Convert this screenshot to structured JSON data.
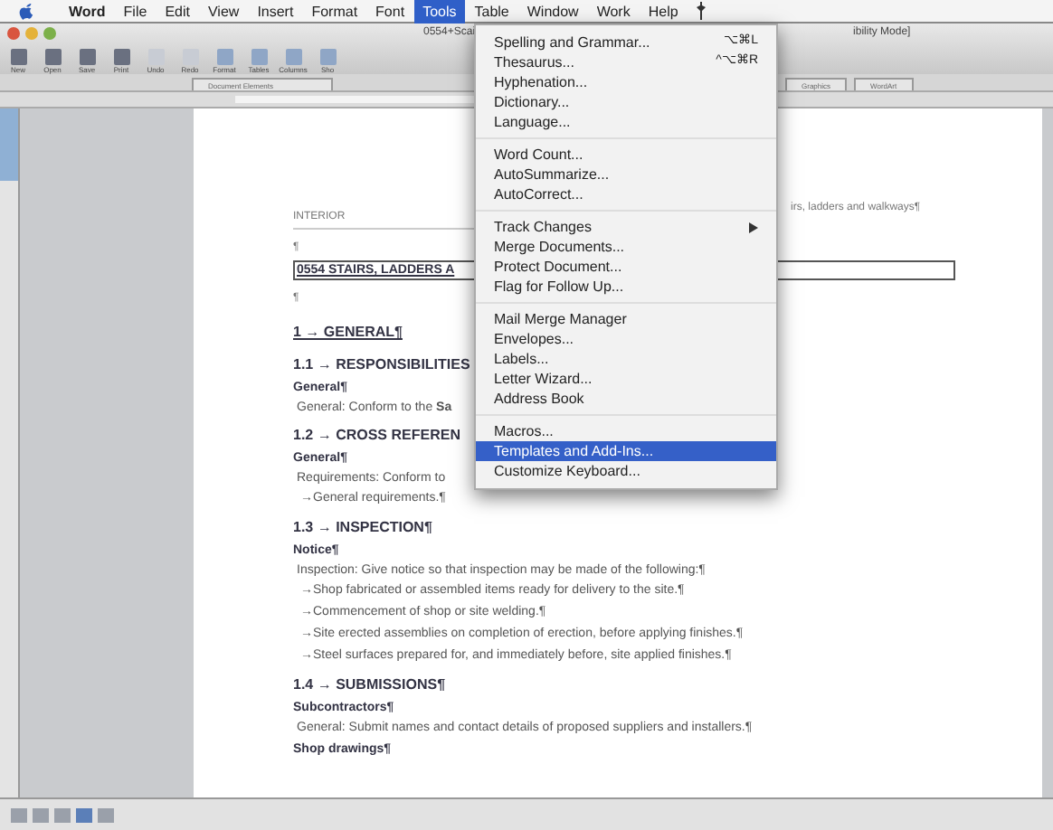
{
  "menubar": [
    {
      "label": "Word",
      "selected": false
    },
    {
      "label": "File",
      "selected": false
    },
    {
      "label": "Edit",
      "selected": false
    },
    {
      "label": "View",
      "selected": false
    },
    {
      "label": "Insert",
      "selected": false
    },
    {
      "label": "Format",
      "selected": false
    },
    {
      "label": "Font",
      "selected": false
    },
    {
      "label": "Tools",
      "selected": true
    },
    {
      "label": "Table",
      "selected": false
    },
    {
      "label": "Window",
      "selected": false
    },
    {
      "label": "Work",
      "selected": false
    },
    {
      "label": "Help",
      "selected": false
    }
  ],
  "window": {
    "title_left": "0554+Scai",
    "title_right": "ibility Mode]"
  },
  "toolbar": [
    {
      "label": "New"
    },
    {
      "label": "Open"
    },
    {
      "label": "Save"
    },
    {
      "label": "Print"
    },
    {
      "label": "Undo"
    },
    {
      "label": "Redo"
    },
    {
      "label": "Format"
    },
    {
      "label": "Tables"
    },
    {
      "label": "Columns"
    },
    {
      "label": "Sho"
    }
  ],
  "ribbon_tabs": [
    {
      "label": "Document Elements",
      "selected": false
    },
    {
      "label": "Graphics",
      "selected": false
    },
    {
      "label": "WordArt",
      "selected": false
    }
  ],
  "tools_menu": [
    {
      "kind": "item",
      "label": "Spelling and Grammar...",
      "shortcut": "⌥⌘L",
      "selected": false
    },
    {
      "kind": "item",
      "label": "Thesaurus...",
      "shortcut": "^⌥⌘R",
      "selected": false
    },
    {
      "kind": "item",
      "label": "Hyphenation...",
      "selected": false
    },
    {
      "kind": "item",
      "label": "Dictionary...",
      "selected": false
    },
    {
      "kind": "item",
      "label": "Language...",
      "selected": false
    },
    {
      "kind": "separator"
    },
    {
      "kind": "item",
      "label": "Word Count...",
      "selected": false
    },
    {
      "kind": "item",
      "label": "AutoSummarize...",
      "selected": false
    },
    {
      "kind": "item",
      "label": "AutoCorrect...",
      "selected": false
    },
    {
      "kind": "separator"
    },
    {
      "kind": "submenu",
      "label": "Track Changes",
      "selected": false
    },
    {
      "kind": "item",
      "label": "Merge Documents...",
      "selected": false
    },
    {
      "kind": "item",
      "label": "Protect Document...",
      "selected": false
    },
    {
      "kind": "item",
      "label": "Flag for Follow Up...",
      "selected": false
    },
    {
      "kind": "separator"
    },
    {
      "kind": "item",
      "label": "Mail Merge Manager",
      "selected": false
    },
    {
      "kind": "item",
      "label": "Envelopes...",
      "selected": false
    },
    {
      "kind": "item",
      "label": "Labels...",
      "selected": false
    },
    {
      "kind": "item",
      "label": "Letter Wizard...",
      "selected": false
    },
    {
      "kind": "item",
      "label": "Address Book",
      "selected": false
    },
    {
      "kind": "separator"
    },
    {
      "kind": "item",
      "label": "Macros...",
      "selected": false
    },
    {
      "kind": "item",
      "label": "Templates and Add-Ins...",
      "selected": true
    },
    {
      "kind": "item",
      "label": "Customize Keyboard...",
      "selected": false
    }
  ],
  "document": {
    "header": "INTERIOR",
    "header_right": "irs, ladders and walkways¶",
    "pilcrow_1": "¶",
    "title": "0554 STAIRS, LADDERS A",
    "pilcrow_2": "¶",
    "lines": [
      {
        "kind": "heading1",
        "text": "1 → GENERAL¶"
      },
      {
        "kind": "heading2",
        "text": "1.1 → RESPONSIBILITIES"
      },
      {
        "kind": "heading3",
        "text": "General¶"
      },
      {
        "kind": "body",
        "text": "General: Conform to the **Sa**"
      },
      {
        "kind": "heading2",
        "text": "1.2 → CROSS REFEREN"
      },
      {
        "kind": "heading3",
        "text": "General¶"
      },
      {
        "kind": "body",
        "text": "Requirements: Conform to"
      },
      {
        "kind": "bullet",
        "text": "→General requirements.¶"
      },
      {
        "kind": "heading2",
        "text": "1.3 → INSPECTION¶"
      },
      {
        "kind": "heading3",
        "text": "Notice¶"
      },
      {
        "kind": "body",
        "text": "Inspection: Give notice so that inspection may be made of the following:¶"
      },
      {
        "kind": "bullet",
        "text": "→Shop fabricated or assembled items ready for delivery to the site.¶"
      },
      {
        "kind": "bullet",
        "text": "→Commencement of shop or site welding.¶"
      },
      {
        "kind": "bullet",
        "text": "→Site erected assemblies on completion of erection, before applying finishes.¶"
      },
      {
        "kind": "bullet",
        "text": "→Steel surfaces prepared for, and immediately before, site applied finishes.¶"
      },
      {
        "kind": "heading2",
        "text": "1.4 → SUBMISSIONS¶"
      },
      {
        "kind": "heading3",
        "text": "Subcontractors¶"
      },
      {
        "kind": "body",
        "text": "General: Submit names and contact details of proposed suppliers and installers.¶"
      },
      {
        "kind": "heading3",
        "text": "Shop drawings¶"
      }
    ]
  }
}
